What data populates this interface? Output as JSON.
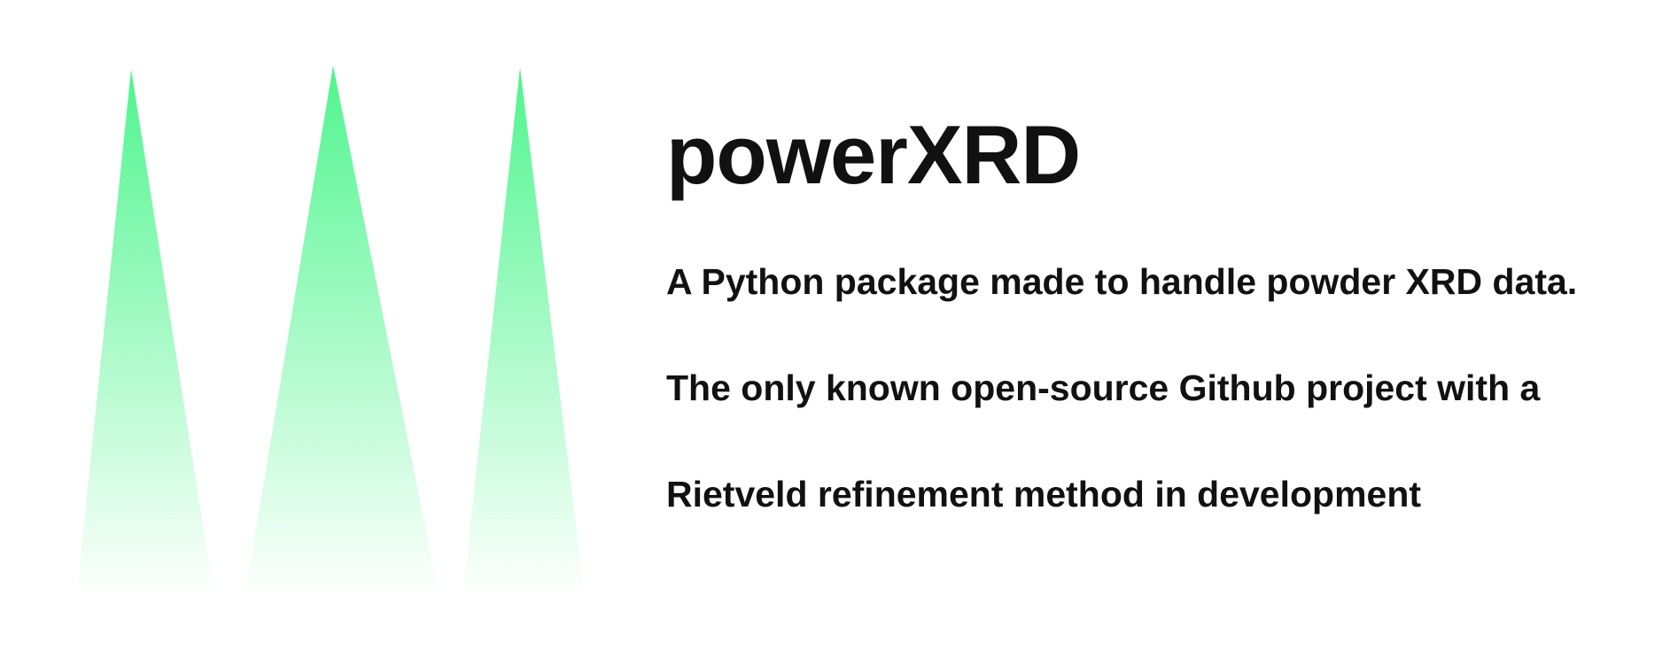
{
  "logo": {
    "icon": "xrd-peaks-logo",
    "peak_color_top": "#4ff58e",
    "peak_color_bottom": "#ffffff"
  },
  "title": "powerXRD",
  "tagline": "A Python package made to handle powder XRD data.",
  "description_lines": [
    "The only known open-source Github project with a",
    "Rietveld refinement method in development"
  ]
}
